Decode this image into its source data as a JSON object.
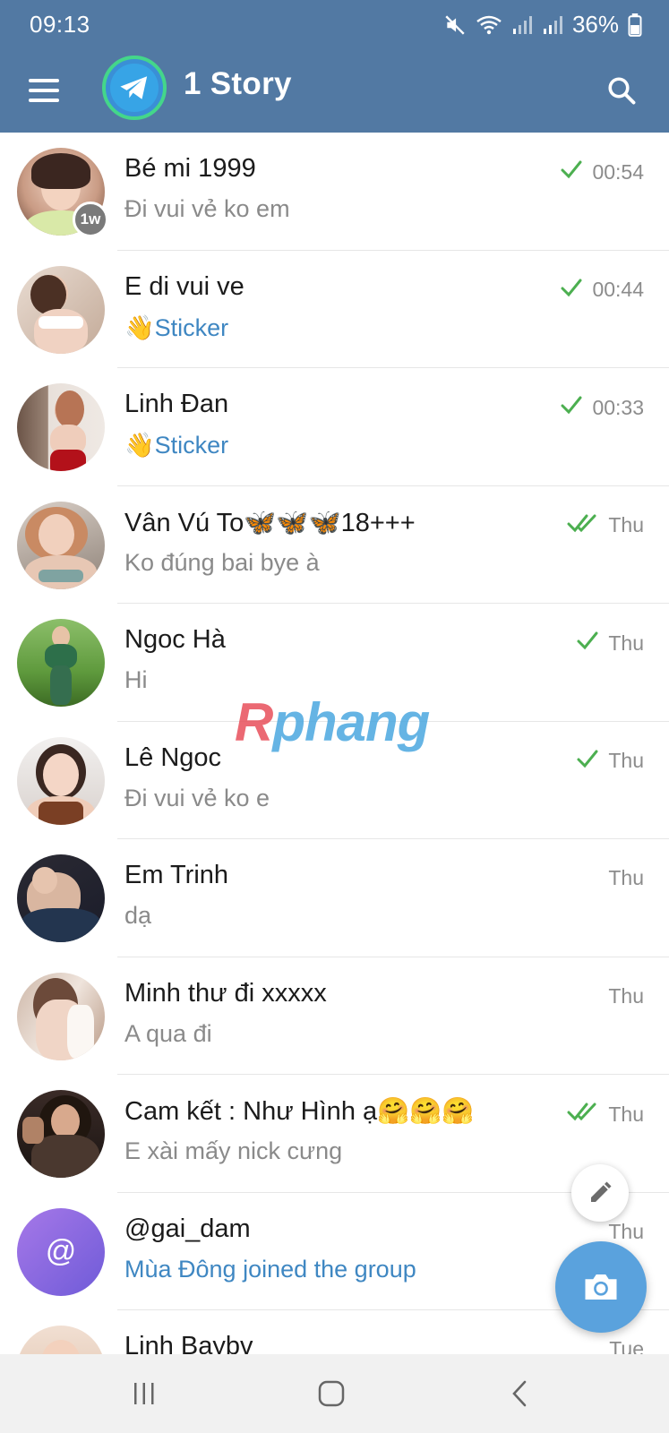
{
  "status_bar": {
    "time": "09:13",
    "battery": "36%",
    "icons": [
      "mute-icon",
      "wifi-icon",
      "signal-icon",
      "signal-icon",
      "battery-icon"
    ]
  },
  "app_bar": {
    "title": "1 Story",
    "menu_icon": "hamburger-menu-icon",
    "logo_icon": "telegram-logo-icon",
    "search_icon": "search-icon",
    "bar_color": "#5279a3"
  },
  "chats": [
    {
      "name": "Bé mi 1999",
      "preview": "Đi vui vẻ ko em",
      "time": "00:54",
      "status": "sent",
      "badge": "1w"
    },
    {
      "name": "E di vui ve",
      "preview": "Sticker",
      "preview_emoji": "👋",
      "preview_accent": true,
      "time": "00:44",
      "status": "sent"
    },
    {
      "name": "Linh Đan",
      "preview": "Sticker",
      "preview_emoji": "👋",
      "preview_accent": true,
      "time": "00:33",
      "status": "sent"
    },
    {
      "name": "Vân Vú To🦋🦋🦋18+++",
      "preview": "Ko đúng bai bye à",
      "time": "Thu",
      "status": "read"
    },
    {
      "name": "Ngoc Hà",
      "preview": "Hi",
      "time": "Thu",
      "status": "sent"
    },
    {
      "name": "Lê Ngoc",
      "preview": "Đi vui vẻ ko e",
      "time": "Thu",
      "status": "sent"
    },
    {
      "name": "Em Trinh",
      "preview": "dạ",
      "time": "Thu",
      "status": "none"
    },
    {
      "name": "Minh thư đi xxxxx",
      "preview": "A qua đi",
      "time": "Thu",
      "status": "none"
    },
    {
      "name": "Cam kết : Như Hình ạ🤗🤗🤗",
      "preview": "E xài mấy nick cưng",
      "time": "Thu",
      "status": "read"
    },
    {
      "name": "@gai_dam",
      "preview": "Mùa Đông joined the group",
      "preview_accent": true,
      "time": "Thu",
      "status": "none",
      "avatar_text": "@"
    },
    {
      "name": "Linh Baybv",
      "preview": "",
      "time": "Tue",
      "status": "none"
    }
  ],
  "watermark": {
    "prefix": "R",
    "rest": "phang"
  },
  "fab": {
    "edit_icon": "pencil-icon",
    "camera_icon": "camera-icon",
    "camera_color": "#5aa2dd"
  },
  "nav_bar": {
    "recents_icon": "recents-icon",
    "home_icon": "home-icon",
    "back_icon": "back-icon"
  },
  "colors": {
    "accent_blue": "#3f87c2",
    "check_green": "#4caf50",
    "muted_text": "#8a8a8a"
  }
}
